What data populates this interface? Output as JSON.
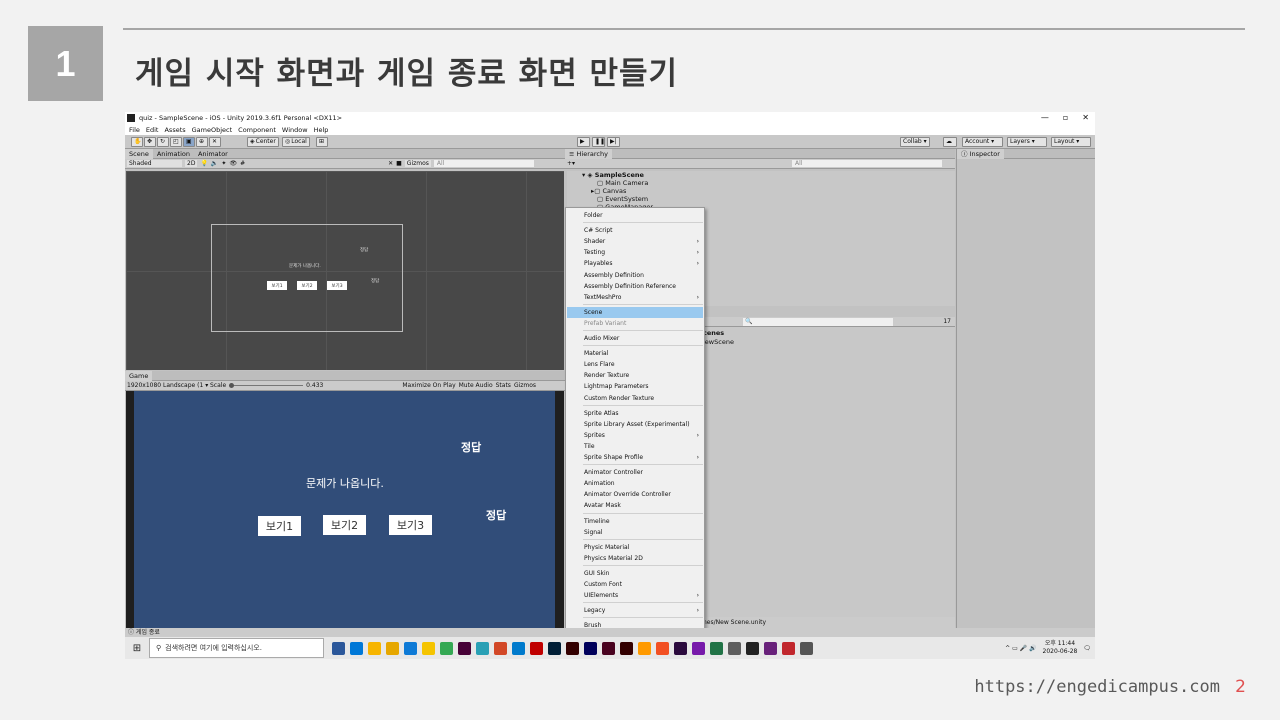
{
  "slide": {
    "number": "1",
    "title": "게임 시작 화면과 게임 종료 화면 만들기",
    "url": "https://engedicampus.com",
    "page_number": "2"
  },
  "window": {
    "title": "quiz - SampleScene - iOS - Unity 2019.3.6f1 Personal <DX11>",
    "controls": [
      "—",
      "▫",
      "✕"
    ]
  },
  "menu": [
    "File",
    "Edit",
    "Assets",
    "GameObject",
    "Component",
    "Window",
    "Help"
  ],
  "toolbar": {
    "center": "Center",
    "local": "Local",
    "collab": "Collab ▾",
    "account": "Account ▾",
    "layers": "Layers ▾",
    "layout": "Layout ▾"
  },
  "scene_panel": {
    "tabs": [
      "Scene",
      "Animation",
      "Animator"
    ],
    "shading": "Shaded",
    "mode_2d": "2D",
    "gizmos": "Gizmos",
    "search_placeholder": "All",
    "question": "문제가 나옵니다.",
    "answer1": "정답",
    "answer2": "정답",
    "buttons": [
      "보기1",
      "보기2",
      "보기3"
    ]
  },
  "game_panel": {
    "tab": "Game",
    "resolution": "1920x1080 Landscape (1 ▾",
    "scale_label": "Scale",
    "scale_value": "0.433",
    "maximize": "Maximize On Play",
    "mute": "Mute Audio",
    "stats": "Stats",
    "gizmos": "Gizmos",
    "question": "문제가 나옵니다.",
    "answer1": "정답",
    "answer2": "정답",
    "buttons": [
      "보기1",
      "보기2",
      "보기3"
    ]
  },
  "hierarchy": {
    "tab": "Hierarchy",
    "search_placeholder": "All",
    "scene": "SampleScene",
    "items": [
      "Main Camera",
      "Canvas",
      "EventSystem",
      "GameManager"
    ]
  },
  "project": {
    "folder_label": "cenes",
    "item": "lewScene",
    "path": "nes/New Scene.unity",
    "count": "17"
  },
  "inspector": {
    "tab": "Inspector"
  },
  "context_menu": {
    "groups": [
      [
        {
          "label": "Folder"
        }
      ],
      [
        {
          "label": "C# Script"
        },
        {
          "label": "Shader",
          "sub": true
        },
        {
          "label": "Testing",
          "sub": true
        },
        {
          "label": "Playables",
          "sub": true
        },
        {
          "label": "Assembly Definition"
        },
        {
          "label": "Assembly Definition Reference"
        },
        {
          "label": "TextMeshPro",
          "sub": true
        }
      ],
      [
        {
          "label": "Scene",
          "highlighted": true
        },
        {
          "label": "Prefab Variant",
          "disabled": true
        }
      ],
      [
        {
          "label": "Audio Mixer"
        }
      ],
      [
        {
          "label": "Material"
        },
        {
          "label": "Lens Flare"
        },
        {
          "label": "Render Texture"
        },
        {
          "label": "Lightmap Parameters"
        },
        {
          "label": "Custom Render Texture"
        }
      ],
      [
        {
          "label": "Sprite Atlas"
        },
        {
          "label": "Sprite Library Asset (Experimental)"
        },
        {
          "label": "Sprites",
          "sub": true
        },
        {
          "label": "Tile"
        },
        {
          "label": "Sprite Shape Profile",
          "sub": true
        }
      ],
      [
        {
          "label": "Animator Controller"
        },
        {
          "label": "Animation"
        },
        {
          "label": "Animator Override Controller"
        },
        {
          "label": "Avatar Mask"
        }
      ],
      [
        {
          "label": "Timeline"
        },
        {
          "label": "Signal"
        }
      ],
      [
        {
          "label": "Physic Material"
        },
        {
          "label": "Physics Material 2D"
        }
      ],
      [
        {
          "label": "GUI Skin"
        },
        {
          "label": "Custom Font"
        },
        {
          "label": "UIElements",
          "sub": true
        }
      ],
      [
        {
          "label": "Legacy",
          "sub": true
        }
      ],
      [
        {
          "label": "Brush"
        },
        {
          "label": "Terrain Layer"
        }
      ]
    ]
  },
  "status": "게임 종료",
  "taskbar": {
    "search_placeholder": "검색하려면 여기에 입력하십시오.",
    "time": "오후 11:44",
    "date": "2020-06-28",
    "app_colors": [
      "#2b579a",
      "#0078d7",
      "#f7b500",
      "#e6a700",
      "#0e7ad6",
      "#f5c400",
      "#34a853",
      "#470137",
      "#2aa0b5",
      "#d24726",
      "#007acc",
      "#c00000",
      "#001e36",
      "#330000",
      "#00005b",
      "#49021f",
      "#330000",
      "#ff9a00",
      "#f25022",
      "#2b0a3d",
      "#7719aa",
      "#217346",
      "#5e5e5e",
      "#222222",
      "#68217a",
      "#c1272d",
      "#555555"
    ]
  }
}
